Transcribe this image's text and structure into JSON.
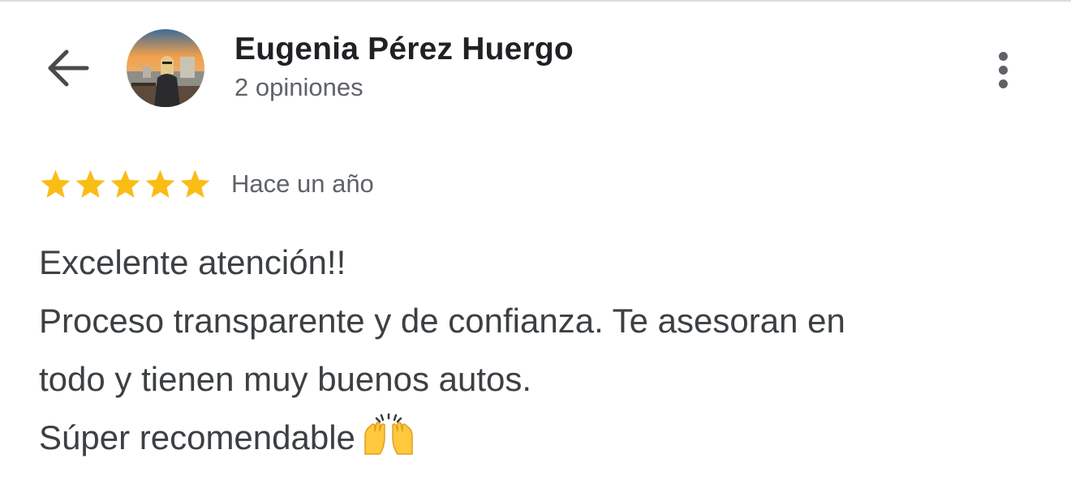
{
  "header": {
    "back_icon": "arrow-back-icon",
    "reviewer_name": "Eugenia Pérez Huergo",
    "review_count": "2 opiniones",
    "more_icon": "more-vert-icon"
  },
  "review": {
    "rating": 5,
    "rating_max": 5,
    "star_color": "#F9BD16",
    "date": "Hace un año",
    "lines": [
      "Excelente atención!!",
      "Proceso transparente y de confianza. Te asesoran en",
      "todo y tienen muy buenos autos.",
      "Súper recomendable"
    ],
    "emoji_icon": "raising-hands-emoji-icon"
  }
}
